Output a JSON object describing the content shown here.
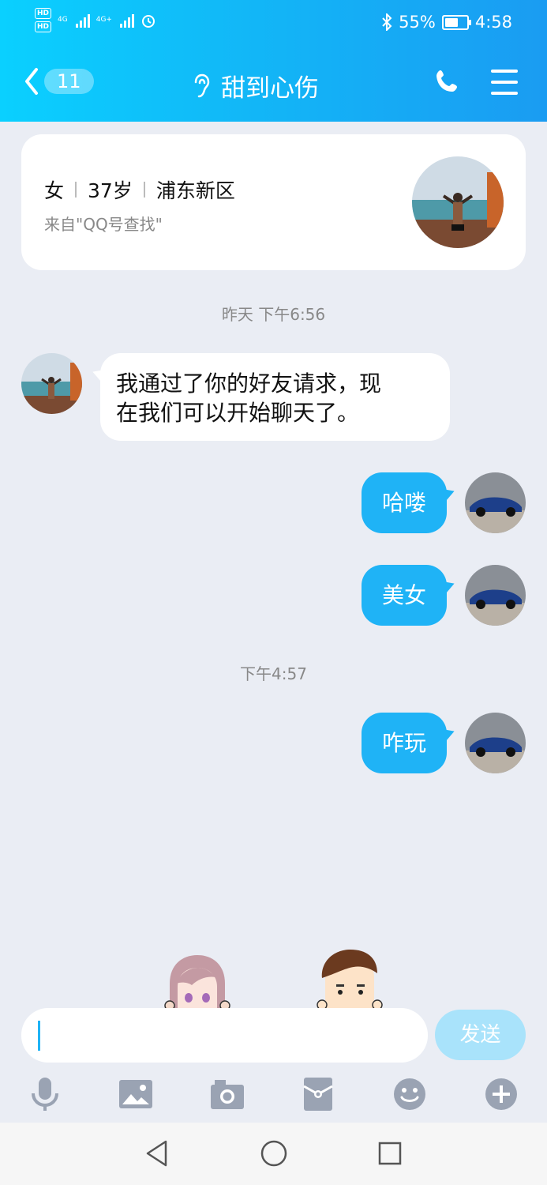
{
  "status_bar": {
    "hd1": "HD",
    "hd2": "HD",
    "net1": "4G",
    "net2": "4G+",
    "battery_percent": "55%",
    "time": "4:58"
  },
  "nav": {
    "unread_count": "11",
    "contact_name": "甜到心伤"
  },
  "profile": {
    "gender": "女",
    "age": "37岁",
    "location": "浦东新区",
    "source": "来自\"QQ号查找\""
  },
  "messages": {
    "time1": "昨天 下午6:56",
    "incoming1_line1": "我通过了你的好友请求，现",
    "incoming1_line2": "在我们可以开始聊天了。",
    "out1": "哈喽",
    "out2": "美女",
    "time2": "下午4:57",
    "out3": "咋玩"
  },
  "input": {
    "send_label": "发送"
  },
  "colors": {
    "accent": "#1fb3f6",
    "background": "#eaedf4"
  }
}
